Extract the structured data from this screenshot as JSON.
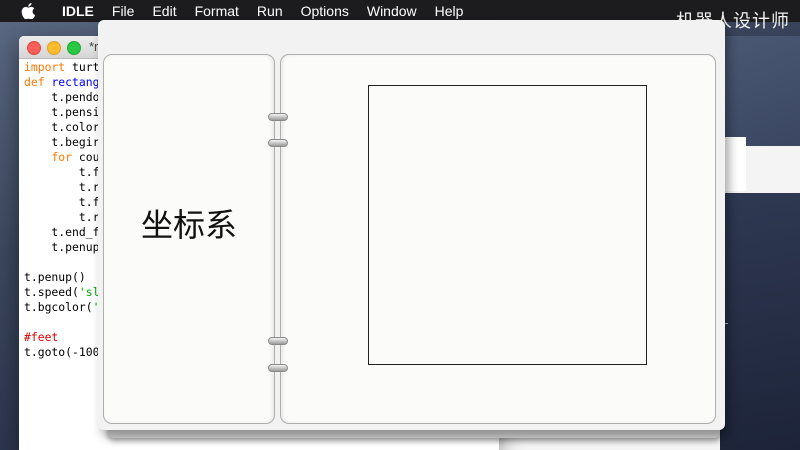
{
  "menubar": {
    "app_name": "IDLE",
    "items": [
      "File",
      "Edit",
      "Format",
      "Run",
      "Options",
      "Window",
      "Help"
    ]
  },
  "watermark": "机器人设计师",
  "editor": {
    "title": "*r",
    "code_lines": [
      "import turt",
      "def rectang",
      "    t.pendo",
      "    t.pensi",
      "    t.color",
      "    t.begir",
      "    for cou",
      "        t.f",
      "        t.r",
      "        t.f",
      "        t.r",
      "    t.end_f",
      "    t.penup",
      "",
      "t.penup()",
      "t.speed('sl",
      "t.bgcolor('",
      "",
      "#feet",
      "t.goto(-100"
    ]
  },
  "notebook": {
    "left_page_title": "坐标系"
  }
}
